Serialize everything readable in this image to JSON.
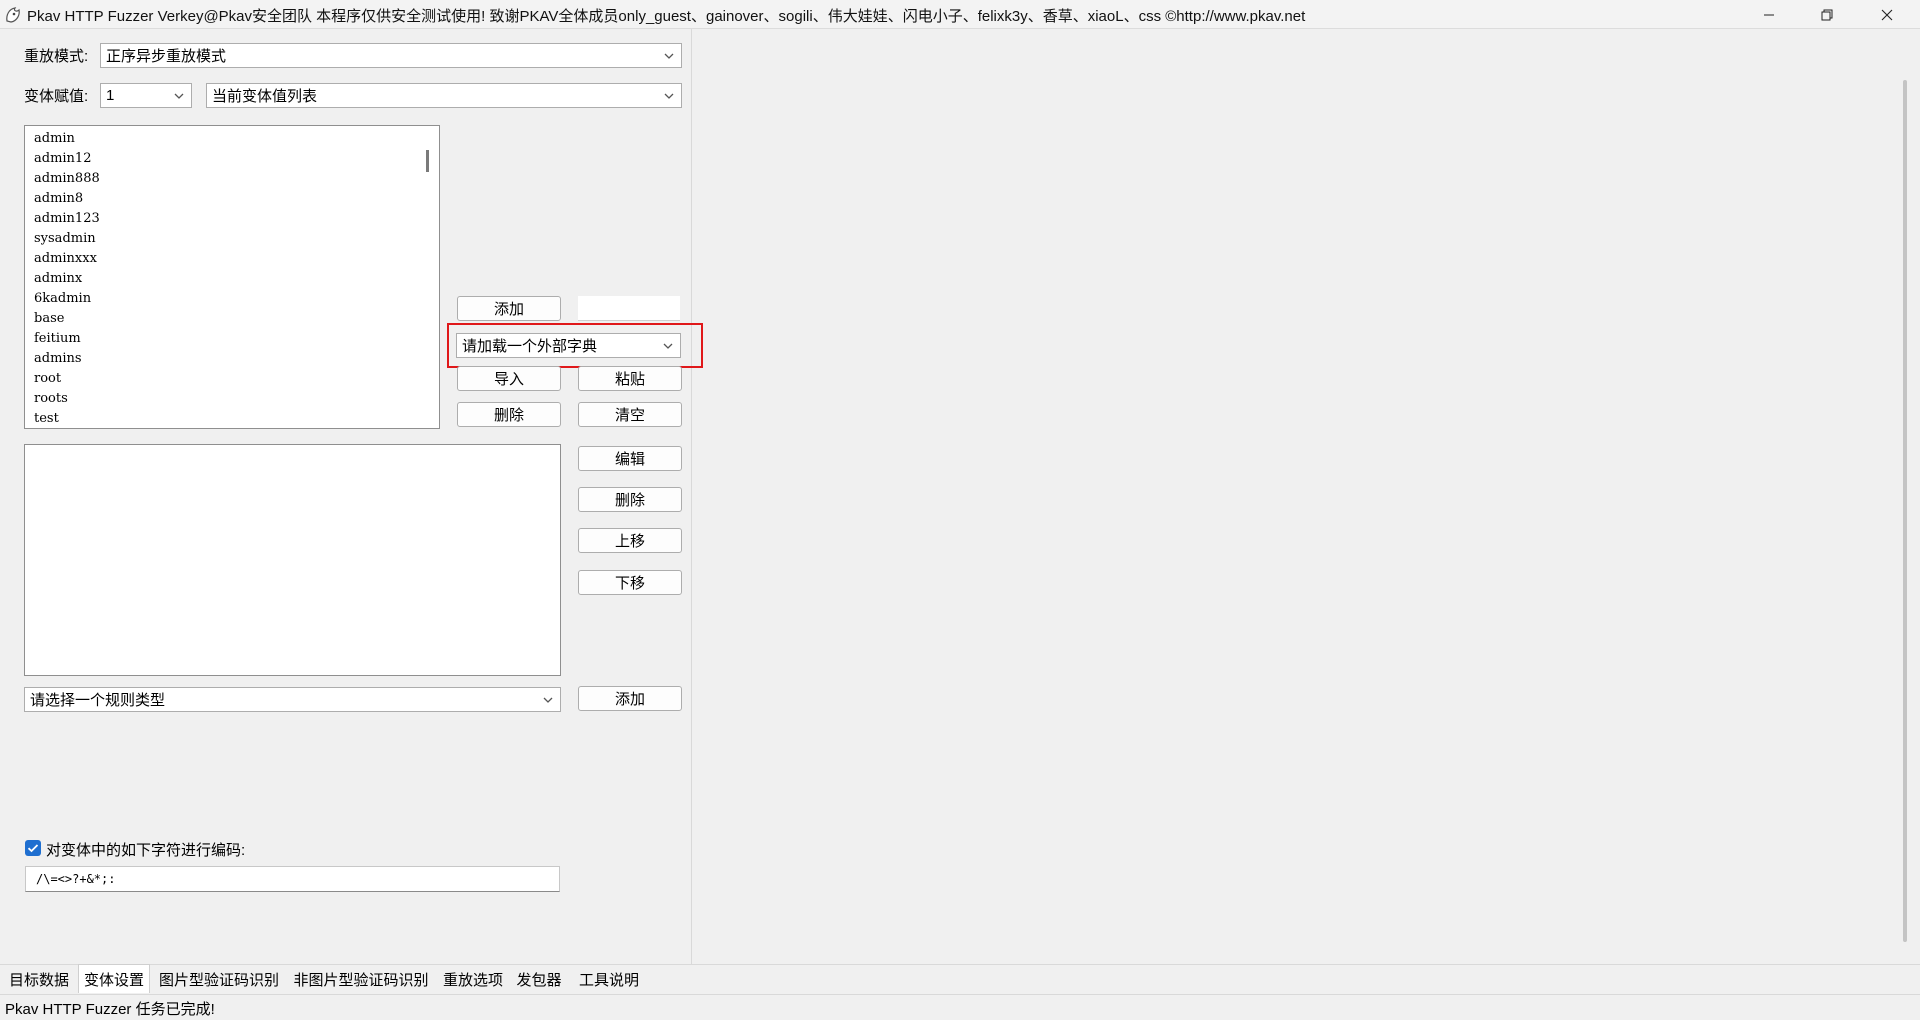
{
  "window": {
    "title": "Pkav HTTP Fuzzer  Verkey@Pkav安全团队  本程序仅供安全测试使用!  致谢PKAV全体成员only_guest、gainover、sogili、伟大娃娃、闪电小子、felixk3y、香草、xiaoL、css  ©http://www.pkav.net",
    "controls": {
      "minimize": "—",
      "restore": "❐",
      "close": "✕"
    }
  },
  "replay": {
    "label": "重放模式:",
    "value": "正序异步重放模式"
  },
  "variant": {
    "label": "变体赋值:",
    "index_value": "1",
    "list_value": "当前变体值列表"
  },
  "values_list": [
    "admin",
    "admin12",
    "admin888",
    "admin8",
    "admin123",
    "sysadmin",
    "adminxxx",
    "adminx",
    "6kadmin",
    "base",
    "feitium",
    "admins",
    "root",
    "roots",
    "test"
  ],
  "value_buttons": {
    "add": "添加",
    "add_input": "",
    "dictionary_select": "请加载一个外部字典",
    "import": "导入",
    "paste": "粘贴",
    "delete": "删除",
    "clear": "清空"
  },
  "rules": {
    "edit": "编辑",
    "delete": "删除",
    "move_up": "上移",
    "move_down": "下移",
    "type_select": "请选择一个规则类型",
    "add": "添加"
  },
  "encoding": {
    "checked": true,
    "label": "对变体中的如下字符进行编码:",
    "chars": "/\\=<>?+&*;:"
  },
  "tabs": [
    {
      "label": "目标数据",
      "active": false
    },
    {
      "label": "变体设置",
      "active": true
    },
    {
      "label": "图片型验证码识别",
      "active": false
    },
    {
      "label": "非图片型验证码识别",
      "active": false
    },
    {
      "label": "重放选项",
      "active": false
    },
    {
      "label": "发包器",
      "active": false
    },
    {
      "label": "工具说明",
      "active": false
    }
  ],
  "status": {
    "text": "Pkav HTTP Fuzzer 任务已完成!"
  },
  "colors": {
    "highlight": "#e0181a",
    "checkbox": "#1f6fd0"
  }
}
